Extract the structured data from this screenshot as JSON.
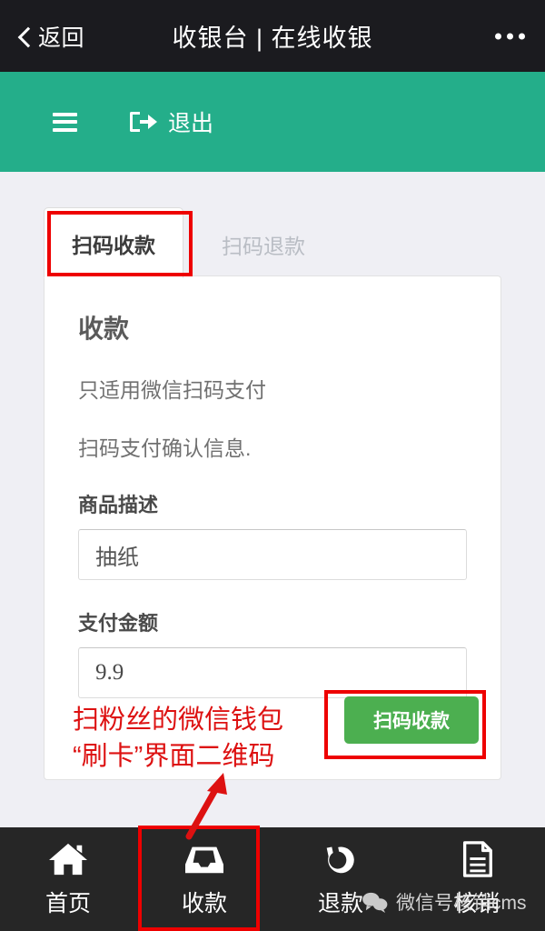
{
  "titlebar": {
    "back_label": "返回",
    "title": "收银台 | 在线收银",
    "more_icon": "more-horizontal-icon"
  },
  "appbar": {
    "menu_icon": "hamburger-menu-icon",
    "logout_icon": "sign-out-icon",
    "logout_label": "退出",
    "background_color": "#24ae8a"
  },
  "tabs": [
    {
      "label": "扫码收款",
      "active": true
    },
    {
      "label": "扫码退款",
      "active": false
    }
  ],
  "card": {
    "heading": "收款",
    "desc_line1": "只适用微信扫码支付",
    "desc_line2": "扫码支付确认信息.",
    "product_label": "商品描述",
    "product_value": "抽纸",
    "amount_label": "支付金额",
    "amount_value": "9.9",
    "pay_button": "扫码收款",
    "pay_button_color": "#4caf50"
  },
  "bottom_nav": [
    {
      "label": "首页",
      "icon": "home-icon",
      "highlighted": false
    },
    {
      "label": "收款",
      "icon": "inbox-icon",
      "highlighted": true
    },
    {
      "label": "退款",
      "icon": "undo-arrow-icon",
      "highlighted": false
    },
    {
      "label": "核销",
      "icon": "document-icon",
      "highlighted": false
    }
  ],
  "annotations": {
    "color": "#dd1111",
    "text_line1": "扫粉丝的微信钱包",
    "text_line2": "“刷卡”界面二维码",
    "boxes": [
      "扫码收款-tab",
      "扫码收款-button",
      "收款-nav-item"
    ]
  },
  "watermark": {
    "icon": "wechat-icon",
    "text": "微信号核销cms"
  }
}
